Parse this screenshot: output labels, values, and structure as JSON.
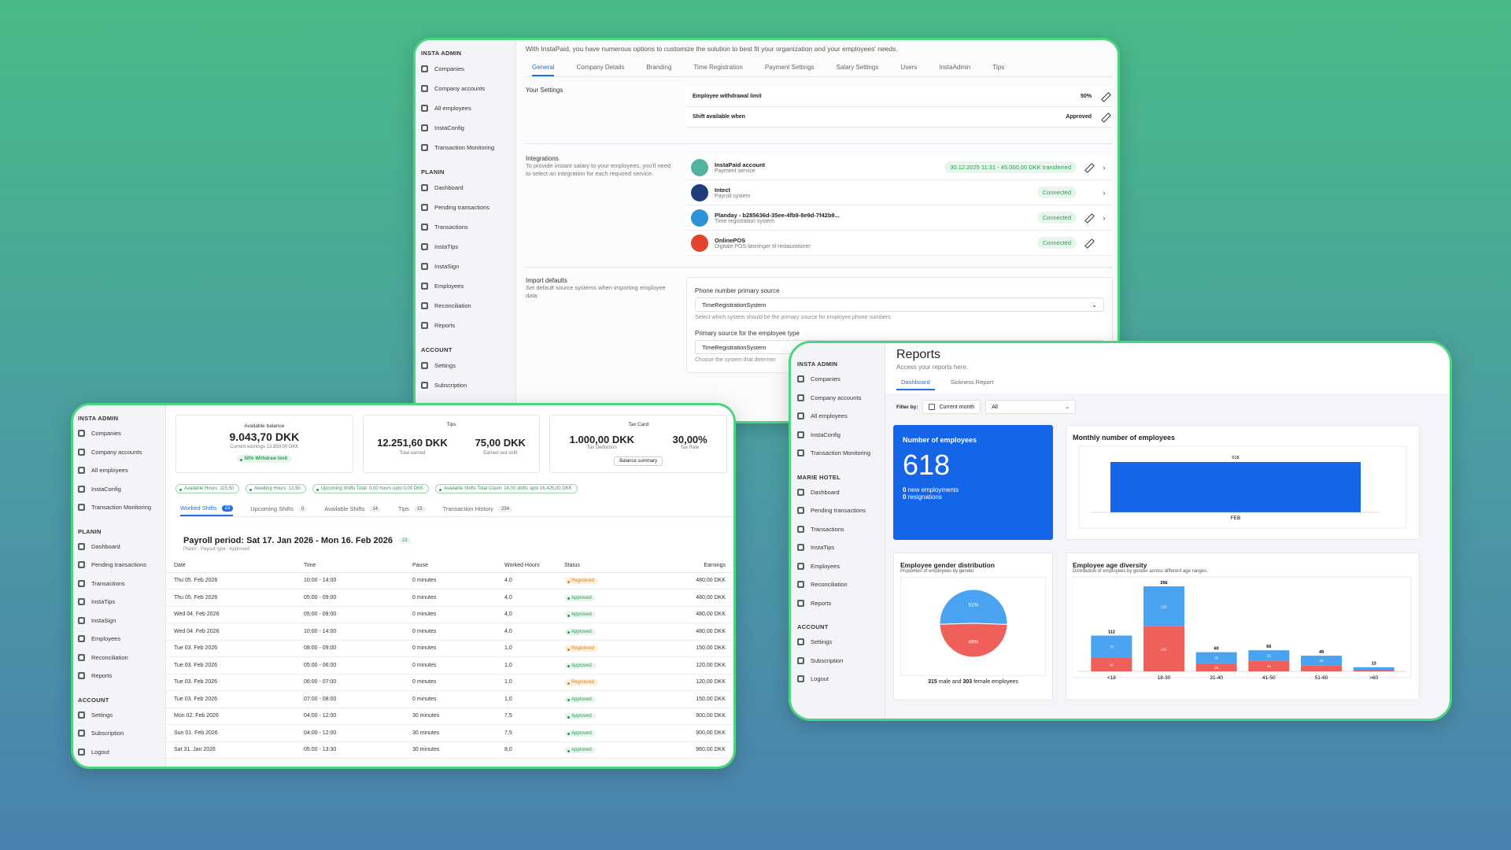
{
  "settings": {
    "top_text": "With InstaPaid, you have numerous options to customize the solution to best fit your organization and your employees' needs.",
    "sidebar": [
      {
        "section": "INSTA ADMIN",
        "items": [
          {
            "label": "Companies",
            "icon": "building-icon"
          },
          {
            "label": "Company accounts",
            "icon": "accounts-icon"
          },
          {
            "label": "All employees",
            "icon": "users-icon"
          },
          {
            "label": "InstaConfig",
            "icon": "config-icon"
          },
          {
            "label": "Transaction Monitoring",
            "icon": "monitor-icon"
          }
        ]
      },
      {
        "section": "PLANIN",
        "items": [
          {
            "label": "Dashboard",
            "icon": "dashboard-icon"
          },
          {
            "label": "Pending transactions",
            "icon": "pending-icon"
          },
          {
            "label": "Transactions",
            "icon": "transactions-icon"
          },
          {
            "label": "InstaTips",
            "icon": "tips-icon"
          },
          {
            "label": "InstaSign",
            "icon": "sign-icon"
          },
          {
            "label": "Employees",
            "icon": "employees-icon"
          },
          {
            "label": "Reconciliation",
            "icon": "reconciliation-icon"
          },
          {
            "label": "Reports",
            "icon": "reports-icon"
          }
        ]
      },
      {
        "section": "ACCOUNT",
        "items": [
          {
            "label": "Settings",
            "icon": "gear-icon"
          },
          {
            "label": "Subscription",
            "icon": "subscription-icon"
          }
        ]
      }
    ],
    "tabs": [
      "General",
      "Company Details",
      "Branding",
      "Time Registration",
      "Payment Settings",
      "Salary Settings",
      "Users",
      "InstaAdmin",
      "Tips"
    ],
    "your_settings": {
      "title": "Your Settings",
      "rows": [
        {
          "label": "Employee withdrawal limit",
          "value": "50%"
        },
        {
          "label": "Shift available when",
          "value": "Approved"
        }
      ]
    },
    "integrations": {
      "title": "Integrations",
      "desc": "To provide instant salary to your employees, you'll need to select an integration for each required service.",
      "rows": [
        {
          "name": "InstaPaid account",
          "sub": "Payment service",
          "status": "30.12.2025 11:31 - 45.000,00 DKK transferred",
          "color": "#4fb3a0",
          "edit": true,
          "arrow": true
        },
        {
          "name": "Intect",
          "sub": "Payroll system",
          "status": "Connected",
          "color": "#1d3e7a",
          "edit": false,
          "arrow": true
        },
        {
          "name": "Planday - b285636d-35ee-4fb9-8e9d-7f42b9...",
          "sub": "Time registration system",
          "status": "Connected",
          "color": "#2b93d6",
          "edit": true,
          "arrow": true
        },
        {
          "name": "OnlinePOS",
          "sub": "Digitale POS-løsninger til restauratiorer",
          "status": "Connected",
          "color": "#e4432b",
          "edit": true,
          "arrow": false
        }
      ]
    },
    "import": {
      "title": "Import defaults",
      "desc": "Set default source systems when importing employee data",
      "f1_label": "Phone number primary source",
      "f1_value": "TimeRegistrationSystem",
      "f1_help": "Select which system should be the primary source for employee phone numbers.",
      "f2_label": "Primary source for the employee type",
      "f2_value": "TimeRegistrationSystem",
      "f2_help": "Choose the system that determin"
    }
  },
  "shifts": {
    "sidebar": [
      {
        "section": "INSTA ADMIN",
        "items": [
          {
            "label": "Companies",
            "icon": "building-icon"
          },
          {
            "label": "Company accounts",
            "icon": "accounts-icon"
          },
          {
            "label": "All employees",
            "icon": "users-icon"
          },
          {
            "label": "InstaConfig",
            "icon": "config-icon"
          },
          {
            "label": "Transaction Monitoring",
            "icon": "monitor-icon"
          }
        ]
      },
      {
        "section": "PLANIN",
        "items": [
          {
            "label": "Dashboard",
            "icon": "dashboard-icon"
          },
          {
            "label": "Pending transactions",
            "icon": "pending-icon"
          },
          {
            "label": "Transactions",
            "icon": "transactions-icon"
          },
          {
            "label": "InstaTips",
            "icon": "tips-icon"
          },
          {
            "label": "InstaSign",
            "icon": "sign-icon"
          },
          {
            "label": "Employees",
            "icon": "employees-icon"
          },
          {
            "label": "Reconciliation",
            "icon": "reconciliation-icon"
          },
          {
            "label": "Reports",
            "icon": "reports-icon"
          }
        ]
      },
      {
        "section": "ACCOUNT",
        "items": [
          {
            "label": "Settings",
            "icon": "gear-icon"
          },
          {
            "label": "Subscription",
            "icon": "subscription-icon"
          },
          {
            "label": "Logout",
            "icon": "logout-icon"
          }
        ]
      }
    ],
    "balance": {
      "title": "Available balance",
      "value": "9.043,70 DKK",
      "sub": "Current earnings 13.850,00 DKK",
      "badge": "50% Withdraw limit"
    },
    "tips": {
      "title": "Tips",
      "v1": "12.251,60 DKK",
      "l1": "Total earned",
      "v2": "75,00 DKK",
      "l2": "Earned last shift"
    },
    "tax": {
      "title": "Tax Card",
      "v1": "1.000,00 DKK",
      "l1": "Tax Deduction",
      "v2": "30,00%",
      "l2": "Tax Rate",
      "btn": "Balance summary"
    },
    "chips": [
      "Available Hours: 115,50",
      "Awaiting Hours: 12,50",
      "Upcoming Shifts Total: 0,00 hours upto 0,00 DKK",
      "Available Shifts Total Count: 14,00 shifts upto 16.425,00 DKK"
    ],
    "tabs": [
      {
        "label": "Worked Shifts",
        "count": "23"
      },
      {
        "label": "Upcoming Shifts",
        "count": "0"
      },
      {
        "label": "Available Shifts",
        "count": "14"
      },
      {
        "label": "Tips",
        "count": "15"
      },
      {
        "label": "Transaction History",
        "count": "234"
      }
    ],
    "payroll_title": "Payroll period: Sat 17. Jan 2026 - Mon 16. Feb 2026",
    "payroll_count": "23",
    "payroll_sub": "Planin - Payout type : Approved",
    "columns": [
      "Date",
      "Time",
      "Pause",
      "Worked Hours",
      "Status",
      "Earnings"
    ],
    "rows": [
      [
        "Thu 05. Feb 2026",
        "10:00 - 14:00",
        "0 minutes",
        "4,0",
        "Registered",
        "480,00 DKK"
      ],
      [
        "Thu 05. Feb 2026",
        "05:00 - 09:00",
        "0 minutes",
        "4,0",
        "Approved",
        "480,00 DKK"
      ],
      [
        "Wed 04. Feb 2026",
        "05:00 - 09:00",
        "0 minutes",
        "4,0",
        "Approved",
        "480,00 DKK"
      ],
      [
        "Wed 04. Feb 2026",
        "10:00 - 14:00",
        "0 minutes",
        "4,0",
        "Approved",
        "480,00 DKK"
      ],
      [
        "Tue 03. Feb 2026",
        "08:00 - 09:00",
        "0 minutes",
        "1,0",
        "Registered",
        "150,00 DKK"
      ],
      [
        "Tue 03. Feb 2026",
        "05:00 - 06:00",
        "0 minutes",
        "1,0",
        "Approved",
        "120,00 DKK"
      ],
      [
        "Tue 03. Feb 2026",
        "06:00 - 07:00",
        "0 minutes",
        "1,0",
        "Registered",
        "120,00 DKK"
      ],
      [
        "Tue 03. Feb 2026",
        "07:00 - 08:00",
        "0 minutes",
        "1,0",
        "Approved",
        "150,00 DKK"
      ],
      [
        "Mon 02. Feb 2026",
        "04:00 - 12:00",
        "30 minutes",
        "7,5",
        "Approved",
        "900,00 DKK"
      ],
      [
        "Sun 01. Feb 2026",
        "04:00 - 12:00",
        "30 minutes",
        "7,5",
        "Approved",
        "900,00 DKK"
      ],
      [
        "Sat 31. Jan 2026",
        "05:00 - 13:30",
        "30 minutes",
        "8,0",
        "Approved",
        "960,00 DKK"
      ]
    ]
  },
  "reports": {
    "title": "Reports",
    "subtitle": "Access your reports here.",
    "tabs": [
      "Dashboard",
      "Sickness Report"
    ],
    "filter_label": "Filter by:",
    "filter_date": "Current month",
    "filter_all": "All",
    "sidebar": [
      {
        "section": "INSTA ADMIN",
        "items": [
          {
            "label": "Companies",
            "icon": "building-icon"
          },
          {
            "label": "Company accounts",
            "icon": "accounts-icon"
          },
          {
            "label": "All employees",
            "icon": "users-icon"
          },
          {
            "label": "InstaConfig",
            "icon": "config-icon"
          },
          {
            "label": "Transaction Monitoring",
            "icon": "monitor-icon"
          }
        ]
      },
      {
        "section": "MARIE HOTEL",
        "items": [
          {
            "label": "Dashboard",
            "icon": "dashboard-icon"
          },
          {
            "label": "Pending transactions",
            "icon": "pending-icon"
          },
          {
            "label": "Transactions",
            "icon": "transactions-icon"
          },
          {
            "label": "InstaTips",
            "icon": "tips-icon"
          },
          {
            "label": "Employees",
            "icon": "employees-icon"
          },
          {
            "label": "Reconciliation",
            "icon": "reconciliation-icon"
          },
          {
            "label": "Reports",
            "icon": "reports-icon"
          }
        ]
      },
      {
        "section": "ACCOUNT",
        "items": [
          {
            "label": "Settings",
            "icon": "gear-icon"
          },
          {
            "label": "Subscription",
            "icon": "subscription-icon"
          },
          {
            "label": "Logout",
            "icon": "logout-icon"
          }
        ]
      }
    ],
    "emp": {
      "title": "Number of employees",
      "value": "618",
      "new_n": "0",
      "new_l": " new employments",
      "res_n": "0",
      "res_l": " resignations"
    },
    "monthly_title": "Monthly number of employees",
    "gender_title": "Employee gender distribution",
    "gender_sub": "Proportion of employees by gender.",
    "gender_foot": {
      "m": "315",
      "ml": " male and ",
      "f": "303",
      "fl": " female employees"
    },
    "age_title": "Employee age diversity",
    "age_sub": "Distribution of employees by gender across different age ranges."
  },
  "chart_data": [
    {
      "type": "bar",
      "categories": [
        "FEB"
      ],
      "values": [
        618
      ],
      "title": "Monthly number of employees",
      "color": "#1565e8"
    },
    {
      "type": "pie",
      "labels": [
        "male",
        "female"
      ],
      "values": [
        51,
        49
      ],
      "colors": [
        "#4aa3f0",
        "#f0605a"
      ]
    },
    {
      "type": "bar",
      "stacked": true,
      "categories": [
        "<18",
        "18-30",
        "31-40",
        "41-50",
        "51-60",
        ">60"
      ],
      "totals": [
        112,
        266,
        60,
        66,
        49,
        13
      ],
      "series": [
        {
          "name": "male",
          "color": "#4aa3f0",
          "values": [
            70,
            125,
            35,
            32,
            30,
            8
          ]
        },
        {
          "name": "female",
          "color": "#f0605a",
          "values": [
            42,
            141,
            25,
            34,
            19,
            5
          ]
        }
      ],
      "title": "Employee age diversity"
    }
  ],
  "colors": {
    "accent": "#1f6fe5",
    "frame": "#4dd47e",
    "ok": "#2c9a54"
  }
}
